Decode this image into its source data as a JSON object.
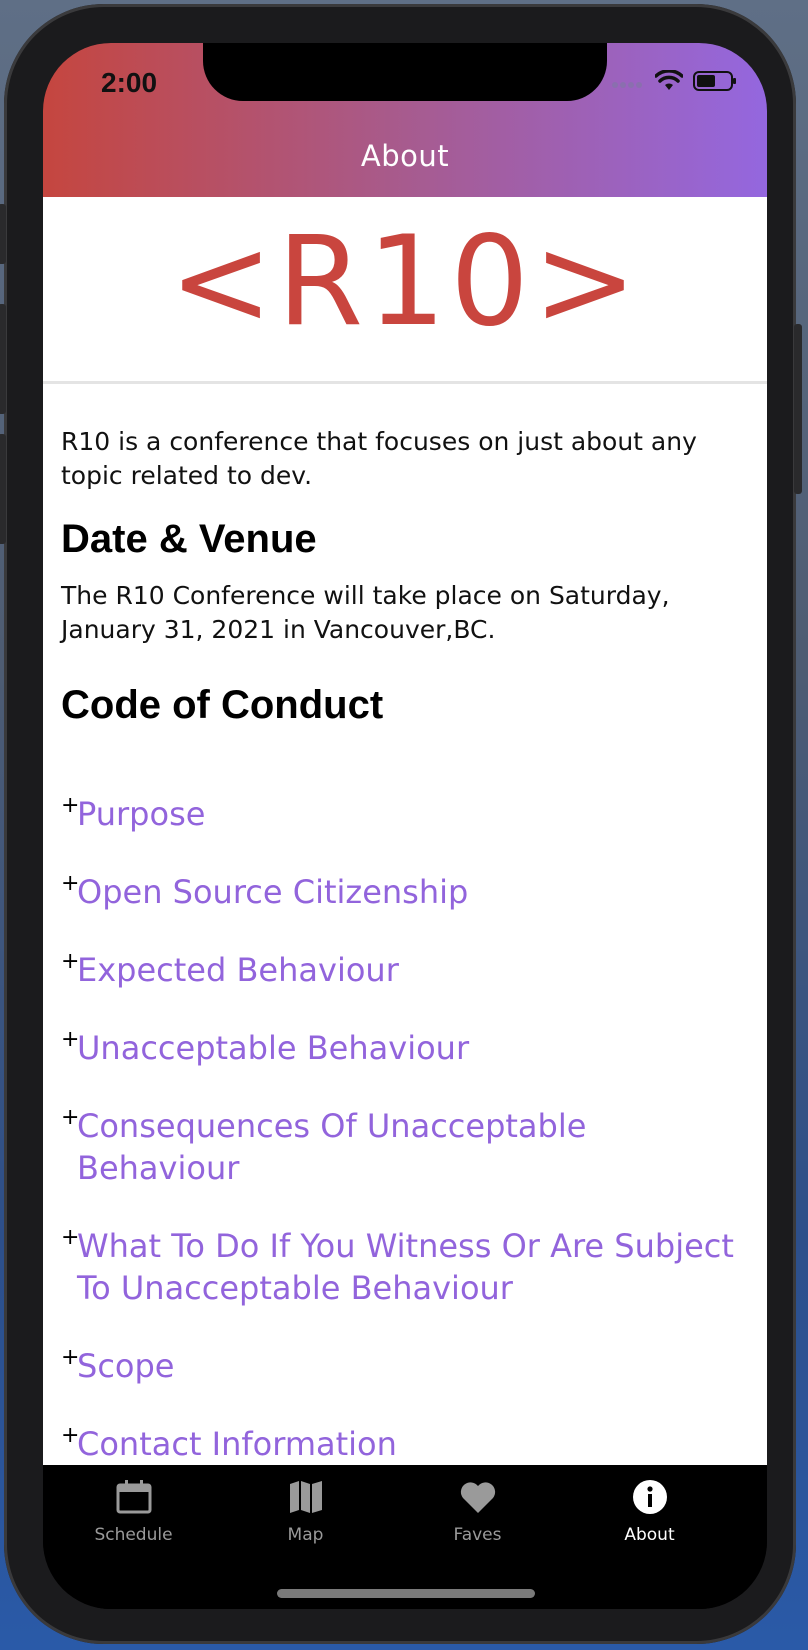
{
  "status_bar": {
    "time": "2:00"
  },
  "header": {
    "title": "About"
  },
  "logo": {
    "text": "<R10>"
  },
  "intro": "R10 is a conference that focuses on just about any topic related to dev.",
  "date_venue": {
    "heading": "Date & Venue",
    "text": "The R10 Conference will take place on Saturday, January 31, 2021 in Vancouver,BC."
  },
  "code_of_conduct": {
    "heading": "Code of Conduct",
    "items": [
      {
        "prefix": "+",
        "label": "Purpose"
      },
      {
        "prefix": "+",
        "label": "Open Source Citizenship"
      },
      {
        "prefix": "+",
        "label": "Expected Behaviour"
      },
      {
        "prefix": "+",
        "label": "Unacceptable Behaviour"
      },
      {
        "prefix": "+",
        "label": "Consequences Of Unacceptable Behaviour"
      },
      {
        "prefix": "+",
        "label": "What To Do If You Witness Or Are Subject To Unacceptable Behaviour"
      },
      {
        "prefix": "+",
        "label": "Scope"
      },
      {
        "prefix": "+",
        "label": "Contact Information"
      }
    ]
  },
  "tabbar": {
    "tabs": [
      {
        "label": "Schedule",
        "icon": "calendar-icon",
        "active": false
      },
      {
        "label": "Map",
        "icon": "map-icon",
        "active": false
      },
      {
        "label": "Faves",
        "icon": "heart-icon",
        "active": false
      },
      {
        "label": "About",
        "icon": "info-icon",
        "active": true
      }
    ]
  },
  "colors": {
    "brand_red": "#c9453e",
    "accent_purple": "#9264dc",
    "header_gradient_start": "#c5463f",
    "header_gradient_end": "#9467df"
  }
}
